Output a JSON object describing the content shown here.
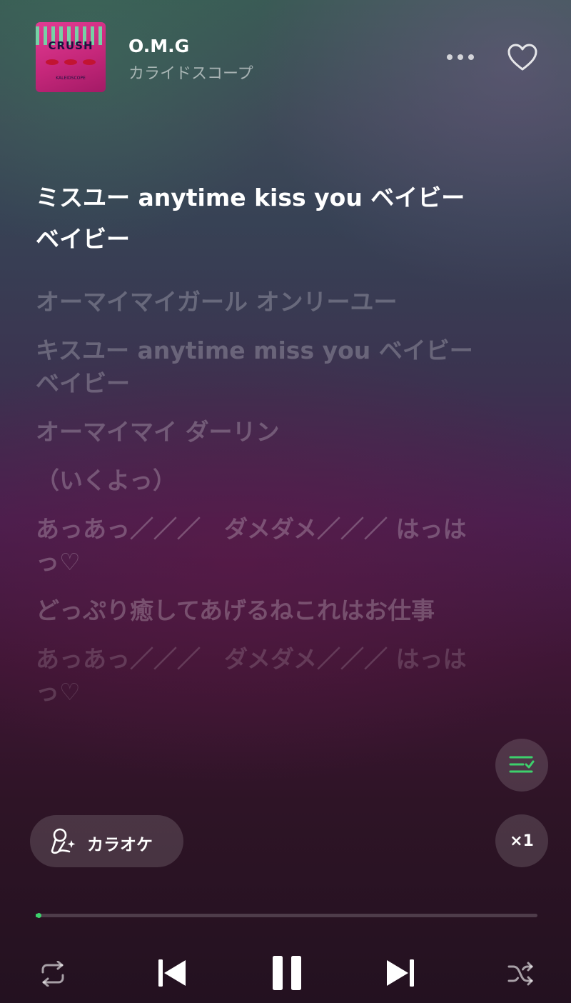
{
  "track": {
    "title": "O.M.G",
    "artist": "カライドスコープ",
    "artwork_text": "CRUSH",
    "artwork_brand": "KALEIDSCOPE"
  },
  "header": {
    "more_icon": "ellipsis-icon",
    "like_icon": "heart-outline-icon"
  },
  "lyrics": {
    "current_index": 0,
    "lines": [
      "ミスユー anytime kiss you ベイビーベイビー",
      "オーマイマイガール オンリーユー",
      "キスユー anytime miss you ベイビーベイビー",
      "オーマイマイ ダーリン",
      "（いくよっ）",
      "あっあっ／／／　ダメダメ／／／ はっはっ♡",
      "どっぷり癒してあげるねこれはお仕事",
      "あっあっ／／／　ダメダメ／／／ はっはっ♡"
    ]
  },
  "controls": {
    "karaoke_label": "カラオケ",
    "speed_label": "×1",
    "progress_fraction": 0.004
  },
  "colors": {
    "accent": "#3dd16c",
    "lyric_inactive": "rgba(255,255,255,0.24)"
  }
}
